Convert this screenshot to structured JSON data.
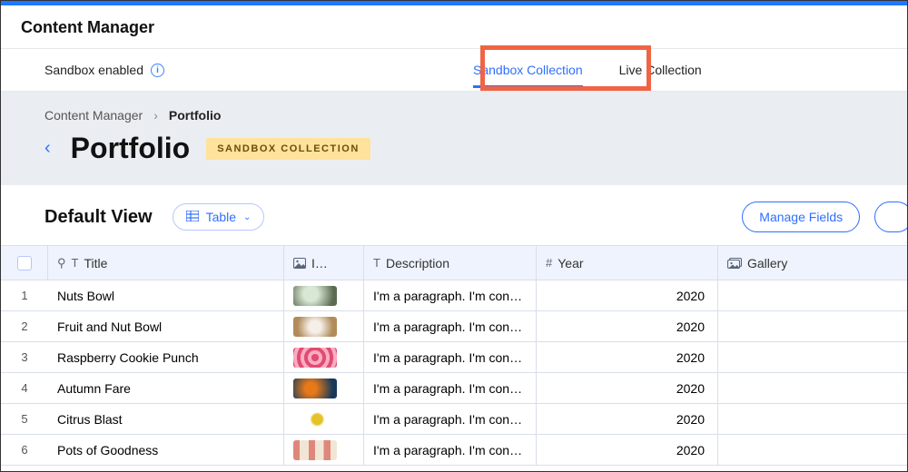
{
  "app_title": "Content Manager",
  "subbar": {
    "sandbox_label": "Sandbox enabled",
    "tabs": {
      "sandbox": "Sandbox Collection",
      "live": "Live Collection"
    },
    "active_tab": "sandbox"
  },
  "breadcrumb": {
    "root": "Content Manager",
    "current": "Portfolio"
  },
  "page": {
    "title": "Portfolio",
    "badge": "SANDBOX COLLECTION"
  },
  "view": {
    "label": "Default View",
    "selector": "Table",
    "manage_fields": "Manage Fields"
  },
  "columns": {
    "title": "Title",
    "image": "I…",
    "description": "Description",
    "year": "Year",
    "gallery": "Gallery"
  },
  "rows": [
    {
      "n": "1",
      "title": "Nuts Bowl",
      "thumbClass": "c1",
      "desc": "I'm a paragraph. I'm conn…",
      "year": "2020"
    },
    {
      "n": "2",
      "title": "Fruit and Nut Bowl",
      "thumbClass": "c2",
      "desc": "I'm a paragraph. I'm conn…",
      "year": "2020"
    },
    {
      "n": "3",
      "title": "Raspberry Cookie Punch",
      "thumbClass": "c3",
      "desc": "I'm a paragraph. I'm conn…",
      "year": "2020"
    },
    {
      "n": "4",
      "title": "Autumn Fare",
      "thumbClass": "c4",
      "desc": "I'm a paragraph. I'm conn…",
      "year": "2020"
    },
    {
      "n": "5",
      "title": "Citrus Blast",
      "thumbClass": "c5",
      "desc": "I'm a paragraph. I'm conn…",
      "year": "2020"
    },
    {
      "n": "6",
      "title": "Pots of Goodness",
      "thumbClass": "c6",
      "desc": "I'm a paragraph. I'm conn…",
      "year": "2020"
    }
  ]
}
